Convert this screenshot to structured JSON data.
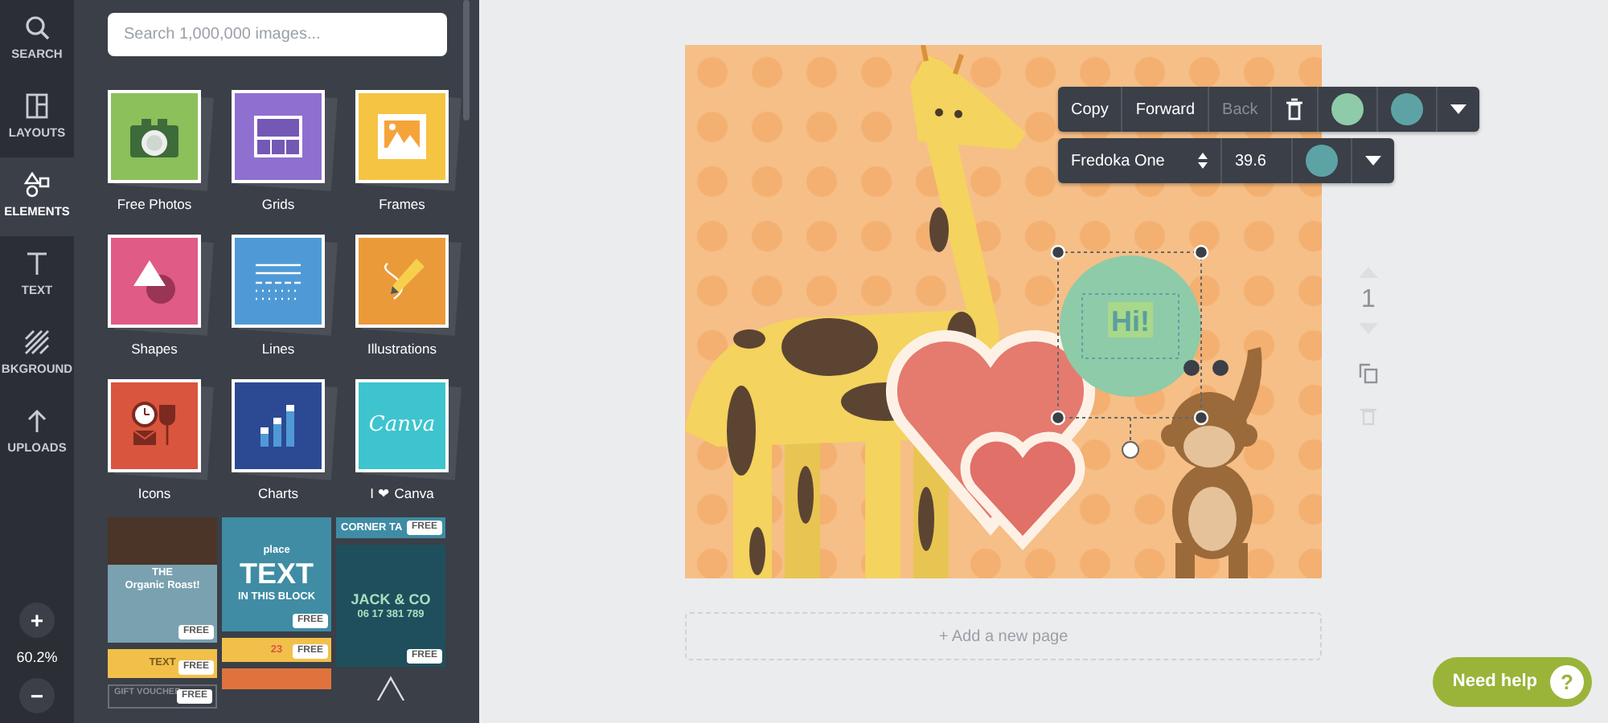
{
  "rail": {
    "items": [
      {
        "label": "SEARCH",
        "kind": "search",
        "selected": false
      },
      {
        "label": "LAYOUTS",
        "kind": "layouts",
        "selected": false
      },
      {
        "label": "ELEMENTS",
        "kind": "elements",
        "selected": true
      },
      {
        "label": "TEXT",
        "kind": "text",
        "selected": false
      },
      {
        "label": "BKGROUND",
        "kind": "background",
        "selected": false
      },
      {
        "label": "UPLOADS",
        "kind": "uploads",
        "selected": false
      }
    ],
    "zoom": {
      "in": "+",
      "level": "60.2%",
      "out": "−"
    }
  },
  "panel": {
    "search": {
      "placeholder": "Search 1,000,000 images..."
    },
    "categories": [
      {
        "label": "Free Photos",
        "kind": "camera",
        "color": "#8cc05a"
      },
      {
        "label": "Grids",
        "kind": "grid",
        "color": "#8f6fd0"
      },
      {
        "label": "Frames",
        "kind": "frame",
        "color": "#f6c443"
      },
      {
        "label": "Shapes",
        "kind": "shapes",
        "color": "#e05b85"
      },
      {
        "label": "Lines",
        "kind": "lines",
        "color": "#4f9ad6"
      },
      {
        "label": "Illustrations",
        "kind": "pencil",
        "color": "#eb9a3a"
      },
      {
        "label": "Icons",
        "kind": "icons",
        "color": "#d9553e"
      },
      {
        "label": "Charts",
        "kind": "chart",
        "color": "#2c4a94"
      },
      {
        "label": "I ❤ Canva",
        "kind": "wordmark",
        "color": "#3ec4cf"
      }
    ],
    "wordmark_tile_text": "Canva",
    "templates": [
      [
        {
          "kind": "roast",
          "texts": [
            "THE",
            "Organic Roast!"
          ],
          "badge": "FREE"
        },
        {
          "kind": "yellow",
          "texts": [
            "TEXT"
          ],
          "badge": "FREE"
        },
        {
          "kind": "voucher",
          "texts": [
            "GIFT VOUCHER"
          ],
          "badge": "FREE"
        }
      ],
      [
        {
          "kind": "place",
          "texts": [
            "place",
            "TEXT",
            "IN THIS BLOCK"
          ],
          "badge": "FREE"
        },
        {
          "kind": "ribbon",
          "texts": [
            "23"
          ],
          "badge": "FREE"
        },
        {
          "kind": "marquee"
        }
      ],
      [
        {
          "kind": "corner",
          "texts": [
            "CORNER TA"
          ],
          "badge": "FREE"
        },
        {
          "kind": "jack",
          "texts": [
            "JACK & CO",
            "06 17 381 789"
          ],
          "badge": "FREE"
        },
        {
          "kind": "triangle"
        }
      ]
    ]
  },
  "toolbar": {
    "buttons": [
      {
        "label": "Copy",
        "disabled": false
      },
      {
        "label": "Forward",
        "disabled": false
      },
      {
        "label": "Back",
        "disabled": true
      }
    ],
    "colors": [
      {
        "color": "#8ecba9"
      },
      {
        "color": "#5da3a5"
      }
    ]
  },
  "text_toolbar": {
    "font": "Fredoka One",
    "size": "39.6",
    "colors": [
      {
        "color": "#5da3a5"
      }
    ]
  },
  "canvas": {
    "bubble_text": "Hi!"
  },
  "page_controls": {
    "number": "1",
    "delete_disabled": true
  },
  "add_page": "+ Add a new page",
  "help": {
    "label": "Need help",
    "icon_text": "?"
  }
}
